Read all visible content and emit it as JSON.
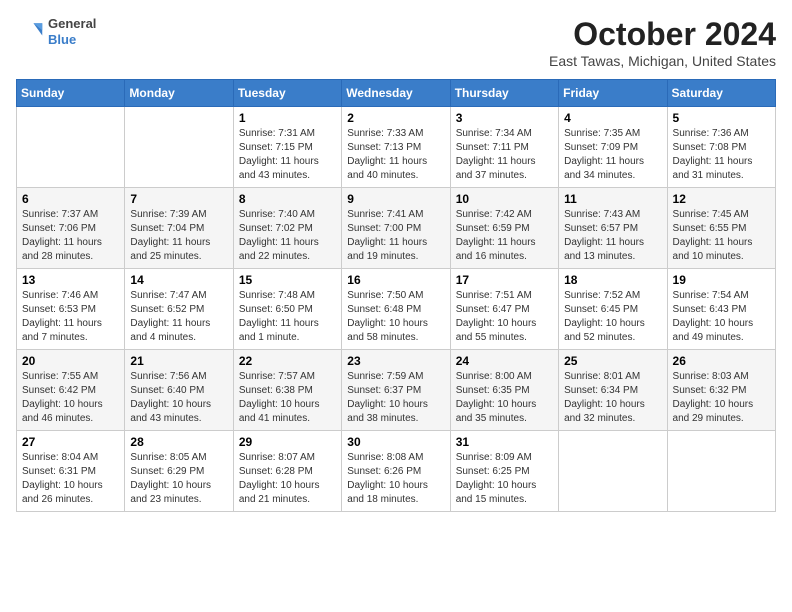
{
  "header": {
    "logo_line1": "General",
    "logo_line2": "Blue",
    "month_title": "October 2024",
    "location": "East Tawas, Michigan, United States"
  },
  "days_of_week": [
    "Sunday",
    "Monday",
    "Tuesday",
    "Wednesday",
    "Thursday",
    "Friday",
    "Saturday"
  ],
  "weeks": [
    [
      {
        "day": "",
        "info": ""
      },
      {
        "day": "",
        "info": ""
      },
      {
        "day": "1",
        "info": "Sunrise: 7:31 AM\nSunset: 7:15 PM\nDaylight: 11 hours and 43 minutes."
      },
      {
        "day": "2",
        "info": "Sunrise: 7:33 AM\nSunset: 7:13 PM\nDaylight: 11 hours and 40 minutes."
      },
      {
        "day": "3",
        "info": "Sunrise: 7:34 AM\nSunset: 7:11 PM\nDaylight: 11 hours and 37 minutes."
      },
      {
        "day": "4",
        "info": "Sunrise: 7:35 AM\nSunset: 7:09 PM\nDaylight: 11 hours and 34 minutes."
      },
      {
        "day": "5",
        "info": "Sunrise: 7:36 AM\nSunset: 7:08 PM\nDaylight: 11 hours and 31 minutes."
      }
    ],
    [
      {
        "day": "6",
        "info": "Sunrise: 7:37 AM\nSunset: 7:06 PM\nDaylight: 11 hours and 28 minutes."
      },
      {
        "day": "7",
        "info": "Sunrise: 7:39 AM\nSunset: 7:04 PM\nDaylight: 11 hours and 25 minutes."
      },
      {
        "day": "8",
        "info": "Sunrise: 7:40 AM\nSunset: 7:02 PM\nDaylight: 11 hours and 22 minutes."
      },
      {
        "day": "9",
        "info": "Sunrise: 7:41 AM\nSunset: 7:00 PM\nDaylight: 11 hours and 19 minutes."
      },
      {
        "day": "10",
        "info": "Sunrise: 7:42 AM\nSunset: 6:59 PM\nDaylight: 11 hours and 16 minutes."
      },
      {
        "day": "11",
        "info": "Sunrise: 7:43 AM\nSunset: 6:57 PM\nDaylight: 11 hours and 13 minutes."
      },
      {
        "day": "12",
        "info": "Sunrise: 7:45 AM\nSunset: 6:55 PM\nDaylight: 11 hours and 10 minutes."
      }
    ],
    [
      {
        "day": "13",
        "info": "Sunrise: 7:46 AM\nSunset: 6:53 PM\nDaylight: 11 hours and 7 minutes."
      },
      {
        "day": "14",
        "info": "Sunrise: 7:47 AM\nSunset: 6:52 PM\nDaylight: 11 hours and 4 minutes."
      },
      {
        "day": "15",
        "info": "Sunrise: 7:48 AM\nSunset: 6:50 PM\nDaylight: 11 hours and 1 minute."
      },
      {
        "day": "16",
        "info": "Sunrise: 7:50 AM\nSunset: 6:48 PM\nDaylight: 10 hours and 58 minutes."
      },
      {
        "day": "17",
        "info": "Sunrise: 7:51 AM\nSunset: 6:47 PM\nDaylight: 10 hours and 55 minutes."
      },
      {
        "day": "18",
        "info": "Sunrise: 7:52 AM\nSunset: 6:45 PM\nDaylight: 10 hours and 52 minutes."
      },
      {
        "day": "19",
        "info": "Sunrise: 7:54 AM\nSunset: 6:43 PM\nDaylight: 10 hours and 49 minutes."
      }
    ],
    [
      {
        "day": "20",
        "info": "Sunrise: 7:55 AM\nSunset: 6:42 PM\nDaylight: 10 hours and 46 minutes."
      },
      {
        "day": "21",
        "info": "Sunrise: 7:56 AM\nSunset: 6:40 PM\nDaylight: 10 hours and 43 minutes."
      },
      {
        "day": "22",
        "info": "Sunrise: 7:57 AM\nSunset: 6:38 PM\nDaylight: 10 hours and 41 minutes."
      },
      {
        "day": "23",
        "info": "Sunrise: 7:59 AM\nSunset: 6:37 PM\nDaylight: 10 hours and 38 minutes."
      },
      {
        "day": "24",
        "info": "Sunrise: 8:00 AM\nSunset: 6:35 PM\nDaylight: 10 hours and 35 minutes."
      },
      {
        "day": "25",
        "info": "Sunrise: 8:01 AM\nSunset: 6:34 PM\nDaylight: 10 hours and 32 minutes."
      },
      {
        "day": "26",
        "info": "Sunrise: 8:03 AM\nSunset: 6:32 PM\nDaylight: 10 hours and 29 minutes."
      }
    ],
    [
      {
        "day": "27",
        "info": "Sunrise: 8:04 AM\nSunset: 6:31 PM\nDaylight: 10 hours and 26 minutes."
      },
      {
        "day": "28",
        "info": "Sunrise: 8:05 AM\nSunset: 6:29 PM\nDaylight: 10 hours and 23 minutes."
      },
      {
        "day": "29",
        "info": "Sunrise: 8:07 AM\nSunset: 6:28 PM\nDaylight: 10 hours and 21 minutes."
      },
      {
        "day": "30",
        "info": "Sunrise: 8:08 AM\nSunset: 6:26 PM\nDaylight: 10 hours and 18 minutes."
      },
      {
        "day": "31",
        "info": "Sunrise: 8:09 AM\nSunset: 6:25 PM\nDaylight: 10 hours and 15 minutes."
      },
      {
        "day": "",
        "info": ""
      },
      {
        "day": "",
        "info": ""
      }
    ]
  ]
}
